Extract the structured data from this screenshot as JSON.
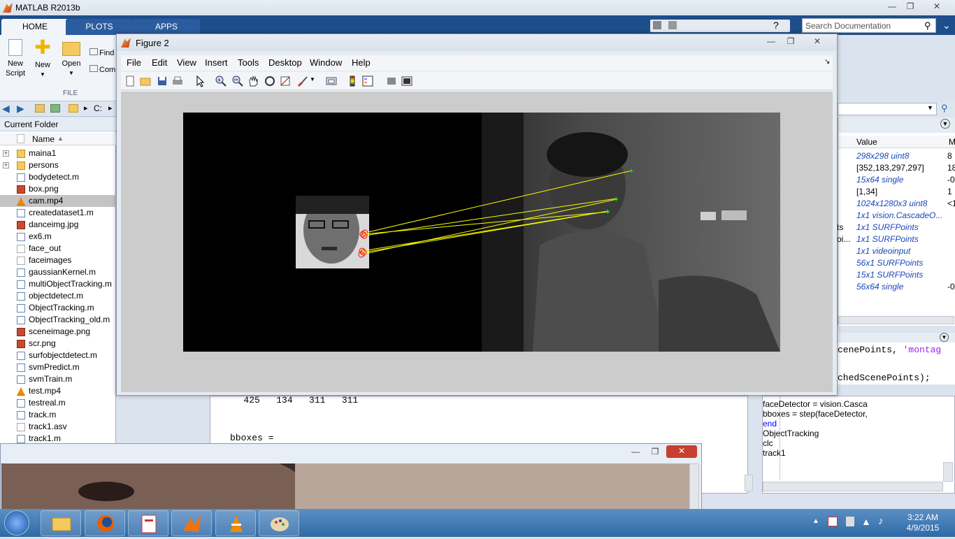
{
  "matlab": {
    "title": "MATLAB R2013b",
    "tabs": [
      "HOME",
      "PLOTS",
      "APPS"
    ],
    "search_placeholder": "Search Documentation",
    "ribbon": {
      "new_script": "New\nScript",
      "new_script_l1": "New",
      "new_script_l2": "Script",
      "new": "New",
      "open": "Open",
      "find": "Find",
      "compare": "Com",
      "section": "FILE"
    },
    "address": "C:"
  },
  "current_folder": {
    "title": "Current Folder",
    "column": "Name",
    "items": [
      {
        "name": "maina1",
        "type": "folder"
      },
      {
        "name": "persons",
        "type": "folder"
      },
      {
        "name": "bodydetect.m",
        "type": "m"
      },
      {
        "name": "box.png",
        "type": "img"
      },
      {
        "name": "cam.mp4",
        "type": "video",
        "selected": true
      },
      {
        "name": "createdataset1.m",
        "type": "m"
      },
      {
        "name": "danceimg.jpg",
        "type": "img"
      },
      {
        "name": "ex6.m",
        "type": "m"
      },
      {
        "name": "face_out",
        "type": "file"
      },
      {
        "name": "faceimages",
        "type": "file"
      },
      {
        "name": "gaussianKernel.m",
        "type": "fn"
      },
      {
        "name": "multiObjectTracking.m",
        "type": "fn"
      },
      {
        "name": "objectdetect.m",
        "type": "m"
      },
      {
        "name": "ObjectTracking.m",
        "type": "m"
      },
      {
        "name": "ObjectTracking_old.m",
        "type": "m"
      },
      {
        "name": "sceneimage.png",
        "type": "img"
      },
      {
        "name": "scr.png",
        "type": "img"
      },
      {
        "name": "surfobjectdetect.m",
        "type": "m"
      },
      {
        "name": "svmPredict.m",
        "type": "fn"
      },
      {
        "name": "svmTrain.m",
        "type": "fn"
      },
      {
        "name": "test.mp4",
        "type": "video"
      },
      {
        "name": "testreal.m",
        "type": "m"
      },
      {
        "name": "track.m",
        "type": "m"
      },
      {
        "name": "track1.asv",
        "type": "file"
      },
      {
        "name": "track1.m",
        "type": "m"
      }
    ]
  },
  "workspace": {
    "col_value": "Value",
    "col_min": "M",
    "rows": [
      {
        "name": "",
        "value": "298x298 uint8",
        "extra": "8",
        "italic": true
      },
      {
        "name": "",
        "value": "[352,183,297,297]",
        "extra": "18",
        "italic": false
      },
      {
        "name": "",
        "value": "15x64 single",
        "extra": "-0",
        "italic": true
      },
      {
        "name": "",
        "value": "[1,34]",
        "extra": "1",
        "italic": false
      },
      {
        "name": "",
        "value": "1024x1280x3 uint8",
        "extra": "<1",
        "italic": true
      },
      {
        "name": "",
        "value": "1x1 vision.CascadeO...",
        "extra": "",
        "italic": true
      },
      {
        "name": "ts",
        "value": "1x1 SURFPoints",
        "extra": "",
        "italic": true
      },
      {
        "name": "oi...",
        "value": "1x1 SURFPoints",
        "extra": "",
        "italic": true
      },
      {
        "name": "",
        "value": "1x1 videoinput",
        "extra": "",
        "italic": true
      },
      {
        "name": "",
        "value": "56x1 SURFPoints",
        "extra": "",
        "italic": true
      },
      {
        "name": "",
        "value": "15x1 SURFPoints",
        "extra": "",
        "italic": true
      },
      {
        "name": "",
        "value": "56x64 single",
        "extra": "-0",
        "italic": true
      }
    ]
  },
  "editor_snippet": {
    "line1_a": "cenePoints, ",
    "line1_b": "'montag",
    "line2": "chedScenePoints);"
  },
  "command_window": {
    "line1": "   425   134   311   311",
    "line2": "bboxes ="
  },
  "history": {
    "lines": [
      {
        "text": "faceDetector = vision.Casca",
        "color": "#000"
      },
      {
        "text": "bboxes = step(faceDetector,",
        "color": "#000"
      },
      {
        "text": "end",
        "color": "#0000ff"
      },
      {
        "text": "ObjectTracking",
        "color": "#000"
      },
      {
        "text": "clc",
        "color": "#000"
      },
      {
        "text": "track1",
        "color": "#000"
      }
    ]
  },
  "figure": {
    "title": "Figure 2",
    "menu": [
      "File",
      "Edit",
      "View",
      "Insert",
      "Tools",
      "Desktop",
      "Window",
      "Help"
    ],
    "toolbar_icons": [
      "new-figure-icon",
      "open-icon",
      "save-icon",
      "print-icon",
      "pointer-icon",
      "zoom-in-icon",
      "zoom-out-icon",
      "pan-icon",
      "rotate-icon",
      "data-cursor-icon",
      "brush-icon",
      "link-icon",
      "colorbar-icon",
      "legend-icon",
      "hide-plot-tools-icon",
      "show-plot-tools-icon"
    ]
  },
  "taskbar": {
    "time": "3:22 AM",
    "date": "4/9/2015",
    "apps": [
      "windows-explorer-icon",
      "firefox-icon",
      "document-icon",
      "matlab-icon",
      "vlc-icon",
      "paint-icon"
    ]
  }
}
